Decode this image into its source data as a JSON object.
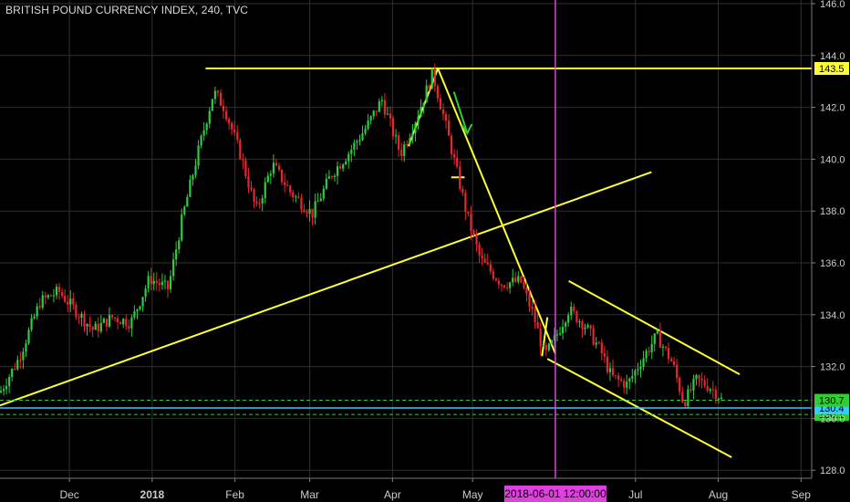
{
  "chart_data": {
    "type": "candlestick",
    "title": "BRITISH POUND CURRENCY INDEX, 240, TVC",
    "x_start": "2017-11-05",
    "x_end": "2018-09-05",
    "x_ticks": [
      {
        "date": "2017-12-01",
        "label": "Dec",
        "bold": false
      },
      {
        "date": "2018-01-01",
        "label": "2018",
        "bold": true
      },
      {
        "date": "2018-02-01",
        "label": "Feb",
        "bold": false
      },
      {
        "date": "2018-03-01",
        "label": "Mar",
        "bold": false
      },
      {
        "date": "2018-04-01",
        "label": "Apr",
        "bold": false
      },
      {
        "date": "2018-05-01",
        "label": "May",
        "bold": false
      },
      {
        "date": "2018-07-01",
        "label": "Jul",
        "bold": false
      },
      {
        "date": "2018-08-01",
        "label": "Aug",
        "bold": false
      },
      {
        "date": "2018-09-01",
        "label": "Sep",
        "bold": false
      }
    ],
    "ylim": [
      127.5,
      146.2
    ],
    "y_ticks": [
      "128.0",
      "130.0",
      "132.0",
      "134.0",
      "136.0",
      "138.0",
      "140.0",
      "142.0",
      "144.0",
      "146.0"
    ],
    "grid": true,
    "price_path": [
      [
        "2017-11-05",
        131.0
      ],
      [
        "2017-11-12",
        132.3
      ],
      [
        "2017-11-20",
        134.5
      ],
      [
        "2017-11-27",
        134.9
      ],
      [
        "2017-12-03",
        134.2
      ],
      [
        "2017-12-10",
        133.4
      ],
      [
        "2017-12-17",
        133.9
      ],
      [
        "2017-12-24",
        133.7
      ],
      [
        "2017-12-31",
        135.4
      ],
      [
        "2018-01-07",
        135.0
      ],
      [
        "2018-01-12",
        137.6
      ],
      [
        "2018-01-18",
        140.2
      ],
      [
        "2018-01-24",
        142.6
      ],
      [
        "2018-01-28",
        142.0
      ],
      [
        "2018-02-03",
        140.2
      ],
      [
        "2018-02-09",
        138.0
      ],
      [
        "2018-02-15",
        139.8
      ],
      [
        "2018-02-22",
        138.7
      ],
      [
        "2018-03-02",
        137.9
      ],
      [
        "2018-03-09",
        139.4
      ],
      [
        "2018-03-16",
        140.3
      ],
      [
        "2018-03-22",
        141.2
      ],
      [
        "2018-03-28",
        142.3
      ],
      [
        "2018-04-04",
        140.2
      ],
      [
        "2018-04-10",
        141.6
      ],
      [
        "2018-04-16",
        143.3
      ],
      [
        "2018-04-20",
        141.7
      ],
      [
        "2018-04-24",
        140.0
      ],
      [
        "2018-04-29",
        137.8
      ],
      [
        "2018-05-04",
        136.1
      ],
      [
        "2018-05-12",
        135.2
      ],
      [
        "2018-05-19",
        135.3
      ],
      [
        "2018-05-24",
        133.9
      ],
      [
        "2018-05-28",
        132.4
      ],
      [
        "2018-06-01",
        133.1
      ],
      [
        "2018-06-06",
        134.2
      ],
      [
        "2018-06-12",
        133.6
      ],
      [
        "2018-06-18",
        132.6
      ],
      [
        "2018-06-22",
        131.6
      ],
      [
        "2018-06-28",
        131.3
      ],
      [
        "2018-07-03",
        132.2
      ],
      [
        "2018-07-09",
        133.2
      ],
      [
        "2018-07-15",
        132.1
      ],
      [
        "2018-07-19",
        130.6
      ],
      [
        "2018-07-24",
        131.5
      ],
      [
        "2018-07-29",
        131.2
      ],
      [
        "2018-08-01",
        130.9
      ],
      [
        "2018-08-03",
        130.6
      ]
    ],
    "drawings": [
      {
        "name": "long-uptrend-line",
        "color": "#ffff33",
        "p1": [
          "2017-11-05",
          130.5
        ],
        "p2": [
          "2018-07-07",
          139.5
        ]
      },
      {
        "name": "resistance-line-143-5",
        "color": "#ffff33",
        "p1": [
          "2018-01-21",
          143.5
        ],
        "p2": [
          "2018-09-05",
          143.5
        ]
      },
      {
        "name": "downtrend-line",
        "color": "#ffff33",
        "p1": [
          "2018-04-18",
          143.5
        ],
        "p2": [
          "2018-06-01",
          132.5
        ]
      },
      {
        "name": "small-up-leg-line",
        "color": "#ffff33",
        "p1": [
          "2018-04-07",
          140.5
        ],
        "p2": [
          "2018-04-18",
          143.5
        ]
      },
      {
        "name": "channel-upper-line",
        "color": "#ffff33",
        "p1": [
          "2018-06-06",
          135.3
        ],
        "p2": [
          "2018-08-09",
          131.7
        ]
      },
      {
        "name": "channel-lower-line",
        "color": "#ffff33",
        "p1": [
          "2018-05-29",
          132.3
        ],
        "p2": [
          "2018-08-06",
          128.5
        ]
      },
      {
        "name": "small-down-leg-line",
        "color": "#ffff33",
        "p1": [
          "2018-05-27",
          132.4
        ],
        "p2": [
          "2018-05-29",
          133.9
        ]
      },
      {
        "name": "support-marker",
        "color": "#ffff33",
        "p1": [
          "2018-04-23",
          139.3
        ],
        "p2": [
          "2018-04-28",
          139.3
        ]
      }
    ],
    "down_arrow": {
      "color": "#33cc33",
      "from": [
        "2018-04-24",
        142.6
      ],
      "to": [
        "2018-04-29",
        141.0
      ]
    },
    "vertical_marker": {
      "date": "2018-06-01",
      "color": "#e040e0",
      "label": "2018-06-01 12:00:00"
    },
    "horizontal_lines": [
      {
        "name": "last-price-line",
        "value": 130.4,
        "color": "#33ccff",
        "label": "130.4"
      },
      {
        "name": "level-130-7-line",
        "value": 130.7,
        "color": "#33cc33",
        "dashed": true,
        "label": "130.7"
      },
      {
        "name": "level-130-1-line",
        "value": 130.15,
        "color": "#33cc33",
        "dashed": true,
        "label": "130.1"
      }
    ],
    "resistance_label": {
      "value": 143.5,
      "label": "143.5",
      "color": "#ffff33"
    },
    "colors": {
      "up": "#2ecc40",
      "down": "#e8262d",
      "grid": "#2f2f2f",
      "axis_text": "#cccccc",
      "background": "#000000"
    }
  }
}
